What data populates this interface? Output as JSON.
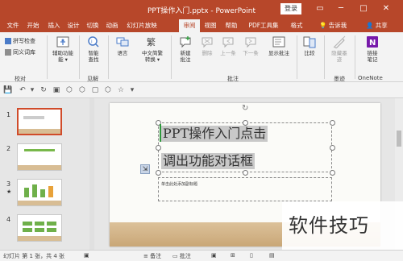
{
  "window": {
    "title": "PPT操作入门.pptx  -  PowerPoint",
    "login_label": "登录",
    "restore_glyph": "▭",
    "minimize_glyph": "─",
    "maximize_glyph": "□",
    "close_glyph": "✕"
  },
  "tabs": [
    "文件",
    "开始",
    "插入",
    "设计",
    "切换",
    "动画",
    "幻灯片放映",
    "审阅",
    "视图",
    "帮助",
    "PDF工具集",
    "格式"
  ],
  "active_tab": "审阅",
  "help_label": "告诉我",
  "share_label": "共享",
  "ribbon": {
    "proofing": {
      "spell_label": "拼写检查",
      "thesaurus_label": "同义词库",
      "group_label": "校对"
    },
    "accessibility": {
      "label": "辅助功能",
      "sub": "能 ▾"
    },
    "insights": {
      "label": "智能",
      "sub": "查找",
      "group_label": "见解"
    },
    "language": {
      "label": "语言"
    },
    "chinese": {
      "label": "中文简繁",
      "sub": "转换 ▾"
    },
    "comments": {
      "new_label": "新建",
      "new_sub": "批注",
      "delete_label": "删除",
      "prev_label": "上一条",
      "next_label": "下一条",
      "show_label": "显示批注",
      "group_label": "批注"
    },
    "compare": {
      "label": "比较"
    },
    "ink": {
      "label": "隐藏墨",
      "sub": "迹",
      "group_label": "墨迹"
    },
    "onenote": {
      "label": "链接",
      "sub": "笔记",
      "group_label": "OneNote"
    }
  },
  "thumbnails": {
    "numbers": [
      "1",
      "2",
      "3",
      "4"
    ],
    "star": "★"
  },
  "slide": {
    "line1": "PPT操作入门点击",
    "line2": "调出功能对话框",
    "subtitle": "单击此处添加副标题"
  },
  "status": {
    "slide_info": "幻灯片 第 1 张，共 4 张",
    "notes_label": "备注",
    "comments_label": "批注"
  },
  "watermark": "软件技巧",
  "colors": {
    "brand": "#b7472a",
    "ribbon_bg": "#f3f3f3",
    "selection": "#d04b2a"
  }
}
